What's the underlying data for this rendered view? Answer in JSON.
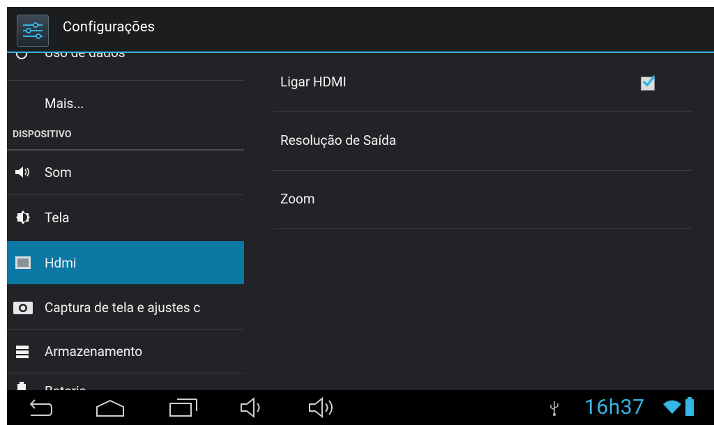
{
  "app": {
    "title": "Configurações",
    "icon": "settings-sliders-icon"
  },
  "sidebar": {
    "items_top": [
      {
        "label": "Uso de dados",
        "icon": "data-usage-icon"
      },
      {
        "label": "Mais...",
        "icon": ""
      }
    ],
    "section_header": "DISPOSITIVO",
    "items": [
      {
        "label": "Som",
        "icon": "speaker-icon"
      },
      {
        "label": "Tela",
        "icon": "brightness-icon"
      },
      {
        "label": "Hdmi",
        "icon": "monitor-icon",
        "selected": true
      },
      {
        "label": "Captura de tela e ajustes c",
        "icon": "camera-icon"
      },
      {
        "label": "Armazenamento",
        "icon": "storage-icon"
      },
      {
        "label": "Bateria",
        "icon": "battery-icon"
      }
    ]
  },
  "hdmi": {
    "rows": [
      {
        "label": "Ligar HDMI",
        "checked": true
      },
      {
        "label": "Resolução de Saída"
      },
      {
        "label": "Zoom"
      }
    ]
  },
  "navbar": {
    "buttons": [
      "back-icon",
      "home-icon",
      "recent-apps-icon",
      "volume-down-icon",
      "volume-up-icon"
    ],
    "status": {
      "time": "16h37",
      "icons": [
        "usb-icon",
        "wifi-icon",
        "battery-icon"
      ]
    }
  },
  "colors": {
    "accent": "#33b5e5",
    "selected": "#0c78a4",
    "background": "#222326"
  }
}
